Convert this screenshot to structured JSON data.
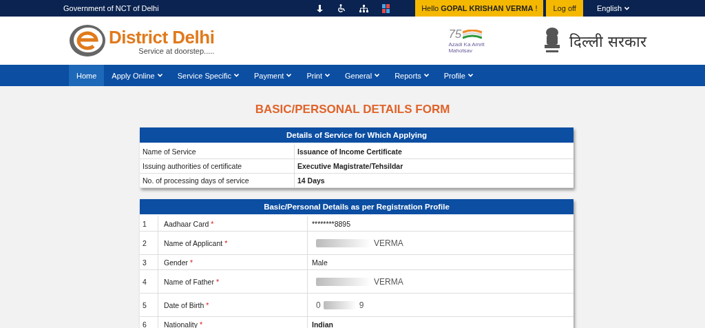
{
  "top_bar": {
    "org": "Government of NCT of Delhi",
    "greeting": "Hello **GOPAL KRISHAN VERMA** !",
    "logoff": "Log off",
    "language": "English"
  },
  "header": {
    "brand": "District Delhi",
    "tagline": "Service at doorstep.....",
    "azadi_number": "75",
    "azadi_text": "Azadi Ka Amrit Mahotsav",
    "govt": "दिल्ली सरकार"
  },
  "nav": [
    {
      "label": "Home",
      "selected": true,
      "dropdown": false
    },
    {
      "label": "Apply Online",
      "selected": false,
      "dropdown": true
    },
    {
      "label": "Service Specific",
      "selected": false,
      "dropdown": true
    },
    {
      "label": "Payment",
      "selected": false,
      "dropdown": true
    },
    {
      "label": "Print",
      "selected": false,
      "dropdown": true
    },
    {
      "label": "General",
      "selected": false,
      "dropdown": true
    },
    {
      "label": "Reports",
      "selected": false,
      "dropdown": true
    },
    {
      "label": "Profile",
      "selected": false,
      "dropdown": true
    }
  ],
  "form_title": "BASIC/PERSONAL DETAILS FORM",
  "service_table": {
    "title": "Details of Service for Which Applying",
    "rows": [
      {
        "label": "Name of Service",
        "value": "Issuance of Income Certificate"
      },
      {
        "label": "Issuing authorities of certificate",
        "value": "Executive Magistrate/Tehsildar"
      },
      {
        "label": "No. of processing days of service",
        "value": "14 Days"
      }
    ]
  },
  "personal_table": {
    "title": "Basic/Personal Details as per Registration Profile",
    "rows": [
      {
        "no": "1",
        "label": "Aadhaar Card",
        "required_mark": "*",
        "kind": "plain",
        "value": "********8895",
        "bold": false
      },
      {
        "no": "2",
        "label": "Name of Applicant",
        "required_mark": "*",
        "kind": "redacted",
        "after": "VERMA"
      },
      {
        "no": "3",
        "label": "Gender",
        "required_mark": "*",
        "kind": "plain",
        "value": "Male",
        "bold": false
      },
      {
        "no": "4",
        "label": "Name of Father",
        "required_mark": "*",
        "kind": "redacted",
        "after": "VERMA"
      },
      {
        "no": "5",
        "label": "Date of Birth",
        "required_mark": "*",
        "kind": "redacted",
        "before": "0",
        "after": "9"
      },
      {
        "no": "6",
        "label": "Nationality",
        "required_mark": "*",
        "kind": "plain",
        "value": "Indian",
        "bold": true
      }
    ]
  }
}
